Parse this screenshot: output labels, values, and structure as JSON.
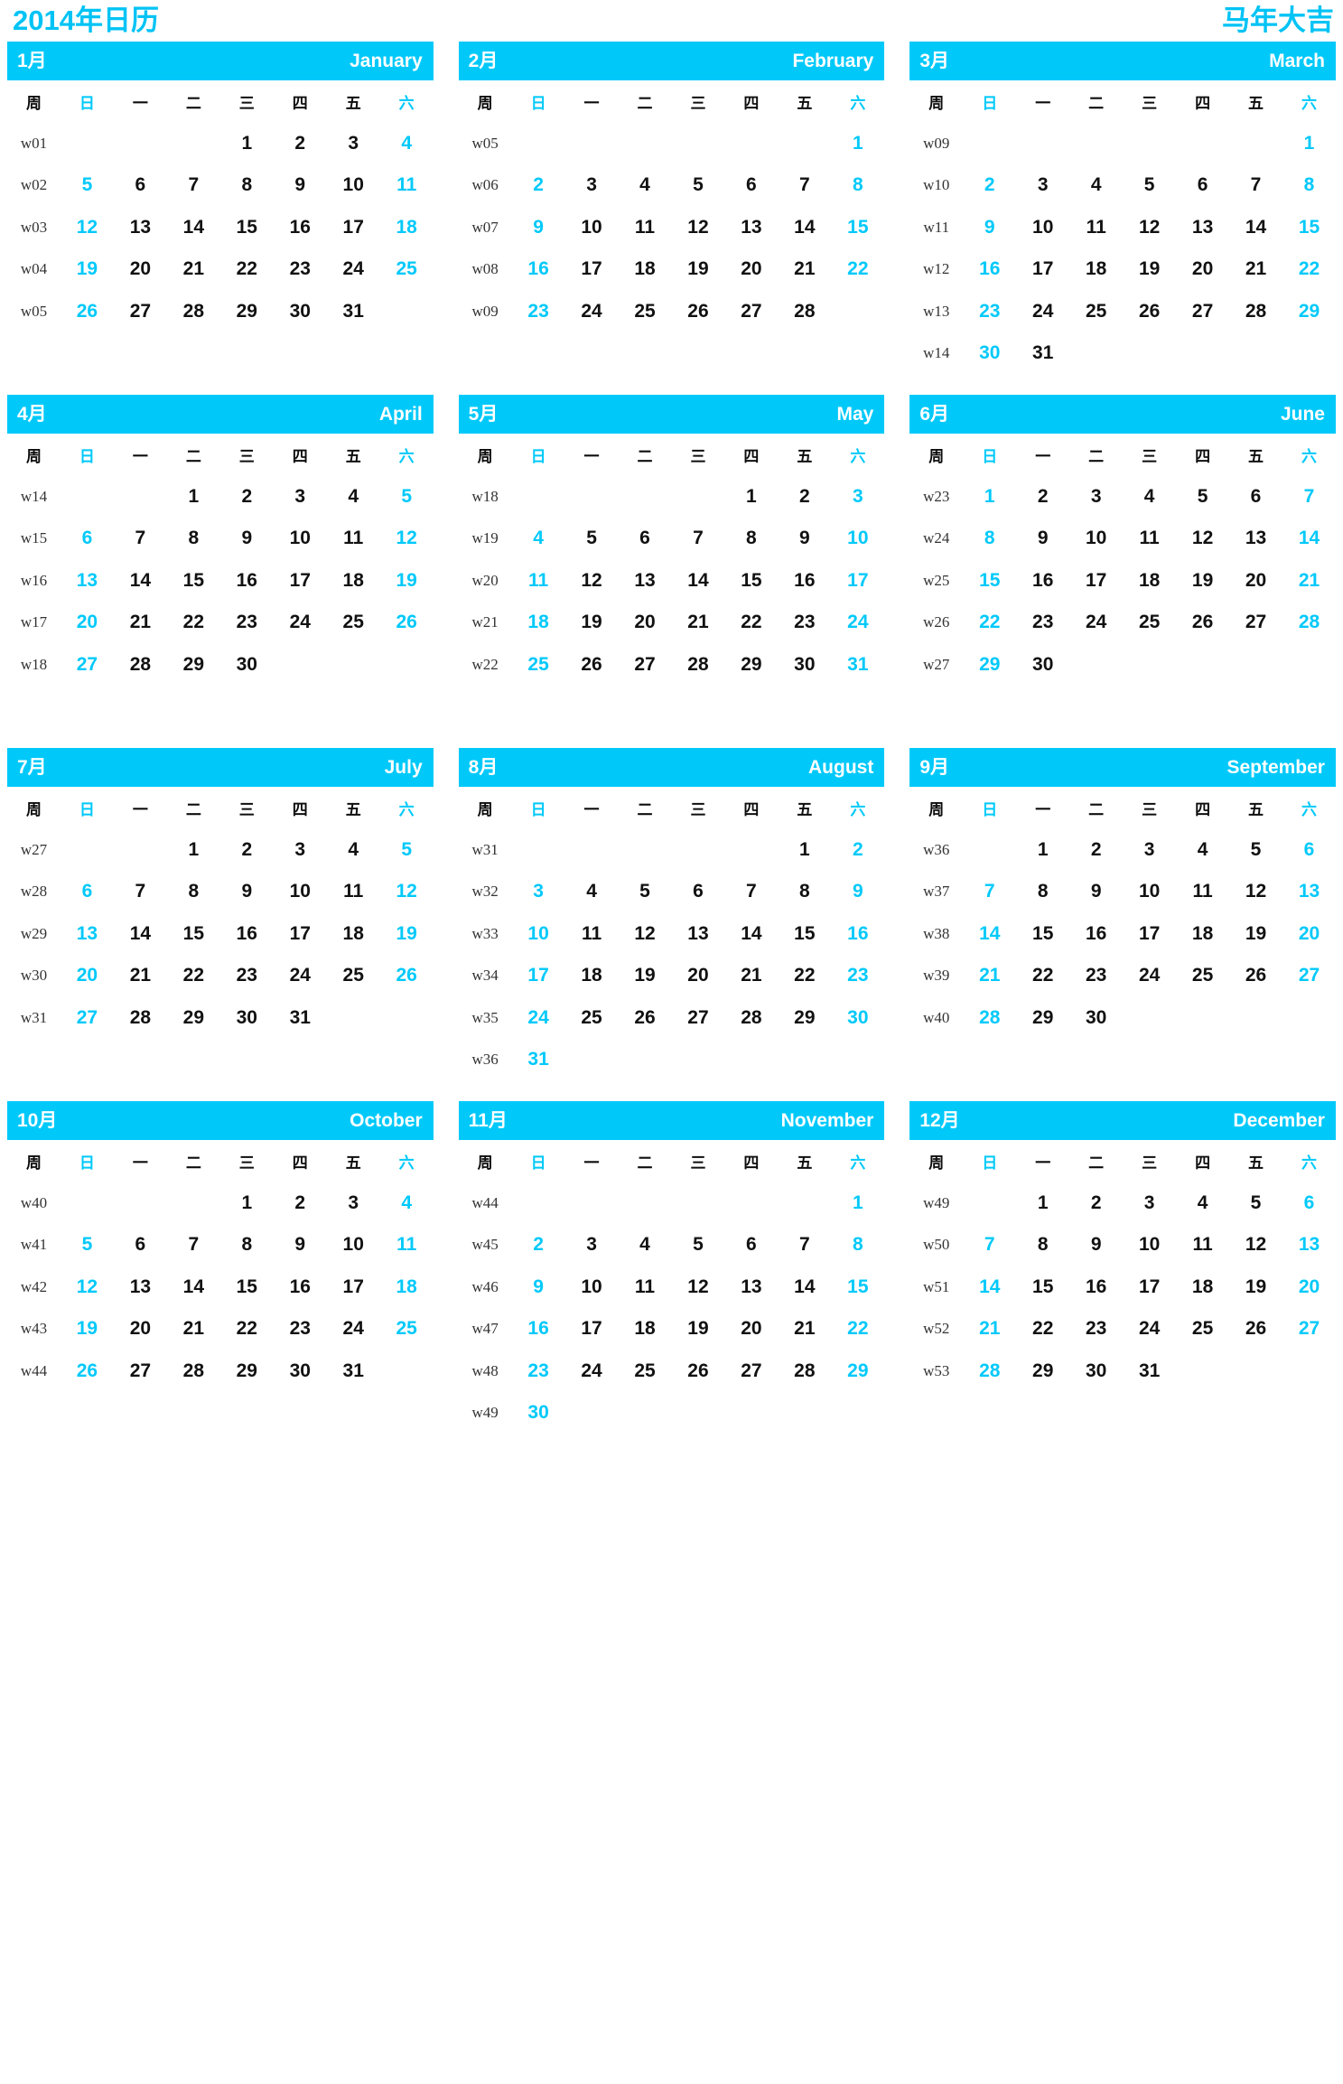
{
  "header": {
    "title_left": "2014年日历",
    "title_right": "马年大吉"
  },
  "colors": {
    "accent": "#00c9fa",
    "title": "#00c3f5",
    "weekday": "#111111",
    "weeknum": "#333333",
    "header_text": "#ffffff",
    "background": "#ffffff"
  },
  "dow_header": {
    "week_label": "周",
    "days": [
      "日",
      "一",
      "二",
      "三",
      "四",
      "五",
      "六"
    ],
    "weekend_indices": [
      0,
      6
    ]
  },
  "months": [
    {
      "cn": "1月",
      "en": "January",
      "weeks": [
        {
          "w": "w01",
          "days": [
            "",
            "",
            "",
            "1",
            "2",
            "3",
            "4"
          ]
        },
        {
          "w": "w02",
          "days": [
            "5",
            "6",
            "7",
            "8",
            "9",
            "10",
            "11"
          ]
        },
        {
          "w": "w03",
          "days": [
            "12",
            "13",
            "14",
            "15",
            "16",
            "17",
            "18"
          ]
        },
        {
          "w": "w04",
          "days": [
            "19",
            "20",
            "21",
            "22",
            "23",
            "24",
            "25"
          ]
        },
        {
          "w": "w05",
          "days": [
            "26",
            "27",
            "28",
            "29",
            "30",
            "31",
            ""
          ]
        }
      ]
    },
    {
      "cn": "2月",
      "en": "February",
      "weeks": [
        {
          "w": "w05",
          "days": [
            "",
            "",
            "",
            "",
            "",
            "",
            "1"
          ]
        },
        {
          "w": "w06",
          "days": [
            "2",
            "3",
            "4",
            "5",
            "6",
            "7",
            "8"
          ]
        },
        {
          "w": "w07",
          "days": [
            "9",
            "10",
            "11",
            "12",
            "13",
            "14",
            "15"
          ]
        },
        {
          "w": "w08",
          "days": [
            "16",
            "17",
            "18",
            "19",
            "20",
            "21",
            "22"
          ]
        },
        {
          "w": "w09",
          "days": [
            "23",
            "24",
            "25",
            "26",
            "27",
            "28",
            ""
          ]
        }
      ]
    },
    {
      "cn": "3月",
      "en": "March",
      "weeks": [
        {
          "w": "w09",
          "days": [
            "",
            "",
            "",
            "",
            "",
            "",
            "1"
          ]
        },
        {
          "w": "w10",
          "days": [
            "2",
            "3",
            "4",
            "5",
            "6",
            "7",
            "8"
          ]
        },
        {
          "w": "w11",
          "days": [
            "9",
            "10",
            "11",
            "12",
            "13",
            "14",
            "15"
          ]
        },
        {
          "w": "w12",
          "days": [
            "16",
            "17",
            "18",
            "19",
            "20",
            "21",
            "22"
          ]
        },
        {
          "w": "w13",
          "days": [
            "23",
            "24",
            "25",
            "26",
            "27",
            "28",
            "29"
          ]
        },
        {
          "w": "w14",
          "days": [
            "30",
            "31",
            "",
            "",
            "",
            "",
            ""
          ]
        }
      ]
    },
    {
      "cn": "4月",
      "en": "April",
      "weeks": [
        {
          "w": "w14",
          "days": [
            "",
            "",
            "1",
            "2",
            "3",
            "4",
            "5"
          ]
        },
        {
          "w": "w15",
          "days": [
            "6",
            "7",
            "8",
            "9",
            "10",
            "11",
            "12"
          ]
        },
        {
          "w": "w16",
          "days": [
            "13",
            "14",
            "15",
            "16",
            "17",
            "18",
            "19"
          ]
        },
        {
          "w": "w17",
          "days": [
            "20",
            "21",
            "22",
            "23",
            "24",
            "25",
            "26"
          ]
        },
        {
          "w": "w18",
          "days": [
            "27",
            "28",
            "29",
            "30",
            "",
            "",
            ""
          ]
        }
      ]
    },
    {
      "cn": "5月",
      "en": "May",
      "weeks": [
        {
          "w": "w18",
          "days": [
            "",
            "",
            "",
            "",
            "1",
            "2",
            "3"
          ]
        },
        {
          "w": "w19",
          "days": [
            "4",
            "5",
            "6",
            "7",
            "8",
            "9",
            "10"
          ]
        },
        {
          "w": "w20",
          "days": [
            "11",
            "12",
            "13",
            "14",
            "15",
            "16",
            "17"
          ]
        },
        {
          "w": "w21",
          "days": [
            "18",
            "19",
            "20",
            "21",
            "22",
            "23",
            "24"
          ]
        },
        {
          "w": "w22",
          "days": [
            "25",
            "26",
            "27",
            "28",
            "29",
            "30",
            "31"
          ]
        }
      ]
    },
    {
      "cn": "6月",
      "en": "June",
      "weeks": [
        {
          "w": "w23",
          "days": [
            "1",
            "2",
            "3",
            "4",
            "5",
            "6",
            "7"
          ]
        },
        {
          "w": "w24",
          "days": [
            "8",
            "9",
            "10",
            "11",
            "12",
            "13",
            "14"
          ]
        },
        {
          "w": "w25",
          "days": [
            "15",
            "16",
            "17",
            "18",
            "19",
            "20",
            "21"
          ]
        },
        {
          "w": "w26",
          "days": [
            "22",
            "23",
            "24",
            "25",
            "26",
            "27",
            "28"
          ]
        },
        {
          "w": "w27",
          "days": [
            "29",
            "30",
            "",
            "",
            "",
            "",
            ""
          ]
        }
      ]
    },
    {
      "cn": "7月",
      "en": "July",
      "weeks": [
        {
          "w": "w27",
          "days": [
            "",
            "",
            "1",
            "2",
            "3",
            "4",
            "5"
          ]
        },
        {
          "w": "w28",
          "days": [
            "6",
            "7",
            "8",
            "9",
            "10",
            "11",
            "12"
          ]
        },
        {
          "w": "w29",
          "days": [
            "13",
            "14",
            "15",
            "16",
            "17",
            "18",
            "19"
          ]
        },
        {
          "w": "w30",
          "days": [
            "20",
            "21",
            "22",
            "23",
            "24",
            "25",
            "26"
          ]
        },
        {
          "w": "w31",
          "days": [
            "27",
            "28",
            "29",
            "30",
            "31",
            "",
            ""
          ]
        }
      ]
    },
    {
      "cn": "8月",
      "en": "August",
      "weeks": [
        {
          "w": "w31",
          "days": [
            "",
            "",
            "",
            "",
            "",
            "1",
            "2"
          ]
        },
        {
          "w": "w32",
          "days": [
            "3",
            "4",
            "5",
            "6",
            "7",
            "8",
            "9"
          ]
        },
        {
          "w": "w33",
          "days": [
            "10",
            "11",
            "12",
            "13",
            "14",
            "15",
            "16"
          ]
        },
        {
          "w": "w34",
          "days": [
            "17",
            "18",
            "19",
            "20",
            "21",
            "22",
            "23"
          ]
        },
        {
          "w": "w35",
          "days": [
            "24",
            "25",
            "26",
            "27",
            "28",
            "29",
            "30"
          ]
        },
        {
          "w": "w36",
          "days": [
            "31",
            "",
            "",
            "",
            "",
            "",
            ""
          ]
        }
      ]
    },
    {
      "cn": "9月",
      "en": "September",
      "weeks": [
        {
          "w": "w36",
          "days": [
            "",
            "1",
            "2",
            "3",
            "4",
            "5",
            "6"
          ]
        },
        {
          "w": "w37",
          "days": [
            "7",
            "8",
            "9",
            "10",
            "11",
            "12",
            "13"
          ]
        },
        {
          "w": "w38",
          "days": [
            "14",
            "15",
            "16",
            "17",
            "18",
            "19",
            "20"
          ]
        },
        {
          "w": "w39",
          "days": [
            "21",
            "22",
            "23",
            "24",
            "25",
            "26",
            "27"
          ]
        },
        {
          "w": "w40",
          "days": [
            "28",
            "29",
            "30",
            "",
            "",
            "",
            ""
          ]
        }
      ]
    },
    {
      "cn": "10月",
      "en": "October",
      "weeks": [
        {
          "w": "w40",
          "days": [
            "",
            "",
            "",
            "1",
            "2",
            "3",
            "4"
          ]
        },
        {
          "w": "w41",
          "days": [
            "5",
            "6",
            "7",
            "8",
            "9",
            "10",
            "11"
          ]
        },
        {
          "w": "w42",
          "days": [
            "12",
            "13",
            "14",
            "15",
            "16",
            "17",
            "18"
          ]
        },
        {
          "w": "w43",
          "days": [
            "19",
            "20",
            "21",
            "22",
            "23",
            "24",
            "25"
          ]
        },
        {
          "w": "w44",
          "days": [
            "26",
            "27",
            "28",
            "29",
            "30",
            "31",
            ""
          ]
        }
      ]
    },
    {
      "cn": "11月",
      "en": "November",
      "weeks": [
        {
          "w": "w44",
          "days": [
            "",
            "",
            "",
            "",
            "",
            "",
            "1"
          ]
        },
        {
          "w": "w45",
          "days": [
            "2",
            "3",
            "4",
            "5",
            "6",
            "7",
            "8"
          ]
        },
        {
          "w": "w46",
          "days": [
            "9",
            "10",
            "11",
            "12",
            "13",
            "14",
            "15"
          ]
        },
        {
          "w": "w47",
          "days": [
            "16",
            "17",
            "18",
            "19",
            "20",
            "21",
            "22"
          ]
        },
        {
          "w": "w48",
          "days": [
            "23",
            "24",
            "25",
            "26",
            "27",
            "28",
            "29"
          ]
        },
        {
          "w": "w49",
          "days": [
            "30",
            "",
            "",
            "",
            "",
            "",
            ""
          ]
        }
      ]
    },
    {
      "cn": "12月",
      "en": "December",
      "weeks": [
        {
          "w": "w49",
          "days": [
            "",
            "1",
            "2",
            "3",
            "4",
            "5",
            "6"
          ]
        },
        {
          "w": "w50",
          "days": [
            "7",
            "8",
            "9",
            "10",
            "11",
            "12",
            "13"
          ]
        },
        {
          "w": "w51",
          "days": [
            "14",
            "15",
            "16",
            "17",
            "18",
            "19",
            "20"
          ]
        },
        {
          "w": "w52",
          "days": [
            "21",
            "22",
            "23",
            "24",
            "25",
            "26",
            "27"
          ]
        },
        {
          "w": "w53",
          "days": [
            "28",
            "29",
            "30",
            "31",
            "",
            "",
            ""
          ]
        }
      ]
    }
  ]
}
